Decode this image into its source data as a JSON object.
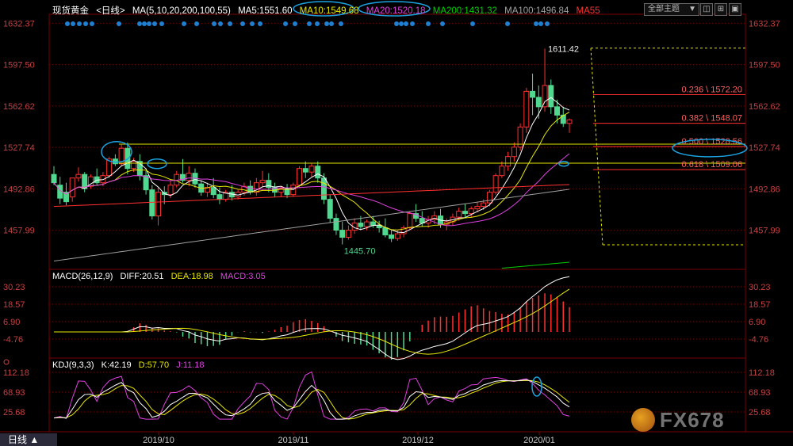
{
  "header": {
    "symbol": "现货黄金",
    "timeframe_tag": "<日线>",
    "ma_title": "MA(5,10,20,200,100,55)",
    "ma5": "MA5:1551.60",
    "ma10": "MA10:1549.68",
    "ma20": "MA20:1520.18",
    "ma200": "MA200:1431.32",
    "ma100": "MA100:1496.84",
    "ma55": "MA55",
    "subject_button": "全部主题",
    "subject_arrow": "▼",
    "icon_box1": "◫",
    "icon_box2": "⊞",
    "icon_box3": "▣"
  },
  "colors": {
    "ma5": "#ffffff",
    "ma10": "#e8e800",
    "ma20": "#e040e0",
    "ma200": "#00d000",
    "ma100": "#a0a0a0",
    "ma55": "#ff3030",
    "up": "#ff3030",
    "down": "#50d890",
    "grid": "#7a0000",
    "axis_text": "#c84040",
    "ellipse": "#1aa3e0",
    "dots": "#1f7fd0"
  },
  "price_axis": [
    "1632.37",
    "1597.50",
    "1562.62",
    "1527.74",
    "1492.86",
    "1457.99"
  ],
  "macd_header": {
    "title": "MACD(26,12,9)",
    "diff": "DIFF:20.51",
    "dea": "DEA:18.98",
    "macd": "MACD:3.05"
  },
  "macd_axis": [
    "30.23",
    "18.57",
    "6.90",
    "-4.76"
  ],
  "kdj_header": {
    "title": "KDJ(9,3,3)",
    "k": "K:42.19",
    "d": "D:57.70",
    "j": "J:11.18"
  },
  "kdj_axis": [
    "112.18",
    "68.93",
    "25.68"
  ],
  "date_axis": [
    "2019/10",
    "2019/11",
    "2019/12",
    "2020/01"
  ],
  "tab_label": "日线 ▲",
  "watermark": "FX678",
  "chart_data": {
    "type": "candlestick",
    "ylim": [
      1425,
      1640
    ],
    "high_label": "1611.42",
    "low_label": "1445.70",
    "candles": [
      [
        1505,
        1512,
        1498,
        1496
      ],
      [
        1496,
        1503,
        1485,
        1480
      ],
      [
        1490,
        1498,
        1482,
        1479
      ],
      [
        1486,
        1500,
        1502,
        1482
      ],
      [
        1502,
        1511,
        1505,
        1499
      ],
      [
        1505,
        1507,
        1493,
        1490
      ],
      [
        1495,
        1505,
        1503,
        1493
      ],
      [
        1503,
        1510,
        1498,
        1496
      ],
      [
        1498,
        1507,
        1504,
        1495
      ],
      [
        1504,
        1520,
        1518,
        1502
      ],
      [
        1518,
        1522,
        1514,
        1512
      ],
      [
        1514,
        1530,
        1527,
        1512
      ],
      [
        1527,
        1532,
        1510,
        1505
      ],
      [
        1510,
        1519,
        1516,
        1507
      ],
      [
        1516,
        1522,
        1504,
        1500
      ],
      [
        1504,
        1508,
        1492,
        1488
      ],
      [
        1492,
        1496,
        1470,
        1467
      ],
      [
        1470,
        1494,
        1490,
        1462
      ],
      [
        1490,
        1495,
        1488,
        1480
      ],
      [
        1488,
        1500,
        1496,
        1485
      ],
      [
        1496,
        1508,
        1505,
        1494
      ],
      [
        1505,
        1518,
        1500,
        1498
      ],
      [
        1500,
        1512,
        1506,
        1495
      ],
      [
        1506,
        1510,
        1497,
        1494
      ],
      [
        1497,
        1500,
        1490,
        1487
      ],
      [
        1490,
        1498,
        1494,
        1486
      ],
      [
        1494,
        1502,
        1488,
        1485
      ],
      [
        1488,
        1494,
        1484,
        1480
      ],
      [
        1484,
        1492,
        1490,
        1482
      ],
      [
        1490,
        1496,
        1486,
        1483
      ],
      [
        1486,
        1492,
        1490,
        1484
      ],
      [
        1490,
        1498,
        1495,
        1487
      ],
      [
        1495,
        1500,
        1490,
        1488
      ],
      [
        1490,
        1502,
        1498,
        1487
      ],
      [
        1498,
        1508,
        1500,
        1494
      ],
      [
        1500,
        1506,
        1494,
        1490
      ],
      [
        1494,
        1498,
        1490,
        1486
      ],
      [
        1490,
        1495,
        1493,
        1486
      ],
      [
        1493,
        1497,
        1488,
        1485
      ],
      [
        1488,
        1498,
        1496,
        1486
      ],
      [
        1496,
        1512,
        1510,
        1494
      ],
      [
        1510,
        1516,
        1507,
        1502
      ],
      [
        1507,
        1514,
        1512,
        1503
      ],
      [
        1512,
        1516,
        1502,
        1498
      ],
      [
        1502,
        1506,
        1484,
        1480
      ],
      [
        1484,
        1488,
        1468,
        1464
      ],
      [
        1468,
        1472,
        1458,
        1454
      ],
      [
        1458,
        1465,
        1452,
        1446
      ],
      [
        1452,
        1462,
        1458,
        1450
      ],
      [
        1458,
        1468,
        1464,
        1455
      ],
      [
        1464,
        1470,
        1461,
        1458
      ],
      [
        1461,
        1467,
        1465,
        1458
      ],
      [
        1465,
        1470,
        1462,
        1460
      ],
      [
        1462,
        1466,
        1460,
        1456
      ],
      [
        1460,
        1468,
        1454,
        1452
      ],
      [
        1454,
        1458,
        1451,
        1448
      ],
      [
        1451,
        1458,
        1455,
        1449
      ],
      [
        1455,
        1462,
        1460,
        1452
      ],
      [
        1460,
        1474,
        1472,
        1458
      ],
      [
        1472,
        1480,
        1468,
        1465
      ],
      [
        1468,
        1474,
        1464,
        1461
      ],
      [
        1464,
        1470,
        1467,
        1460
      ],
      [
        1467,
        1474,
        1470,
        1463
      ],
      [
        1470,
        1476,
        1463,
        1460
      ],
      [
        1463,
        1468,
        1465,
        1458
      ],
      [
        1465,
        1472,
        1469,
        1462
      ],
      [
        1469,
        1477,
        1474,
        1466
      ],
      [
        1474,
        1480,
        1472,
        1468
      ],
      [
        1472,
        1478,
        1476,
        1469
      ],
      [
        1476,
        1482,
        1478,
        1473
      ],
      [
        1478,
        1484,
        1481,
        1475
      ],
      [
        1481,
        1492,
        1490,
        1478
      ],
      [
        1490,
        1506,
        1504,
        1488
      ],
      [
        1504,
        1516,
        1512,
        1502
      ],
      [
        1512,
        1524,
        1520,
        1508
      ],
      [
        1520,
        1532,
        1528,
        1516
      ],
      [
        1528,
        1548,
        1545,
        1525
      ],
      [
        1545,
        1578,
        1575,
        1540
      ],
      [
        1575,
        1590,
        1570,
        1555
      ],
      [
        1570,
        1580,
        1562,
        1552
      ],
      [
        1562,
        1611,
        1580,
        1558
      ],
      [
        1580,
        1585,
        1562,
        1556
      ],
      [
        1562,
        1568,
        1555,
        1548
      ],
      [
        1555,
        1562,
        1548,
        1545
      ],
      [
        1548,
        1552,
        1551,
        1540
      ]
    ],
    "fib_levels": [
      {
        "label": "0.236 \\ 1572.20",
        "value": 1572.2
      },
      {
        "label": "0.382 \\ 1548.07",
        "value": 1548.07
      },
      {
        "label": "0.500 \\ 1528.56",
        "value": 1528.56
      },
      {
        "label": "0.618 \\ 1509.06",
        "value": 1509.06
      }
    ],
    "fib_range": [
      1611.42,
      1445.7
    ],
    "support_lines": [
      1530.5,
      1514.5
    ]
  }
}
